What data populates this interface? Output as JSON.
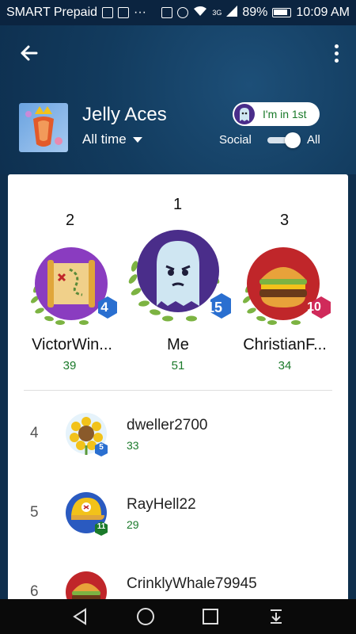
{
  "status_bar": {
    "carrier": "SMART Prepaid",
    "network_type": "3G",
    "battery": "89%",
    "time": "10:09 AM"
  },
  "header": {
    "back_icon": "arrow-left-icon",
    "more_icon": "more-vert-icon",
    "game_title": "Jelly Aces",
    "time_filter": "All time",
    "rank_chip_label": "I'm in 1st",
    "social_label": "Social",
    "all_label": "All",
    "toggle_on": true
  },
  "podium": [
    {
      "rank": "2",
      "name": "VictorWin...",
      "score": "39",
      "level": "4",
      "level_color": "#2a6fd0",
      "bg_color": "#8a3cc0",
      "avatar": "treasure-map-avatar"
    },
    {
      "rank": "1",
      "name": "Me",
      "score": "51",
      "level": "15",
      "level_color": "#2a6fd0",
      "bg_color": "#4a2d8a",
      "avatar": "ghost-avatar"
    },
    {
      "rank": "3",
      "name": "ChristianF...",
      "score": "34",
      "level": "10",
      "level_color": "#d02a5a",
      "bg_color": "#c0262a",
      "avatar": "burger-avatar"
    }
  ],
  "list": [
    {
      "rank": "4",
      "name": "dweller2700",
      "score": "33",
      "level": "5",
      "level_color": "#2a6fd0",
      "avatar": "sunflower-avatar"
    },
    {
      "rank": "5",
      "name": "RayHell22",
      "score": "29",
      "level": "11",
      "level_color": "#1a7a2a",
      "avatar": "baseball-cap-avatar"
    },
    {
      "rank": "6",
      "name": "CrinklyWhale79945",
      "score": "",
      "level": "",
      "level_color": "#d02a5a",
      "avatar": "burger-avatar"
    }
  ],
  "nav_bar": {
    "back": "nav-back-icon",
    "home": "nav-home-icon",
    "recents": "nav-recents-icon",
    "notifications": "nav-pulldown-icon"
  },
  "colors": {
    "header_bg": "#123b5e",
    "score_green": "#1a7a2a",
    "laurel_green": "#7cb342"
  }
}
